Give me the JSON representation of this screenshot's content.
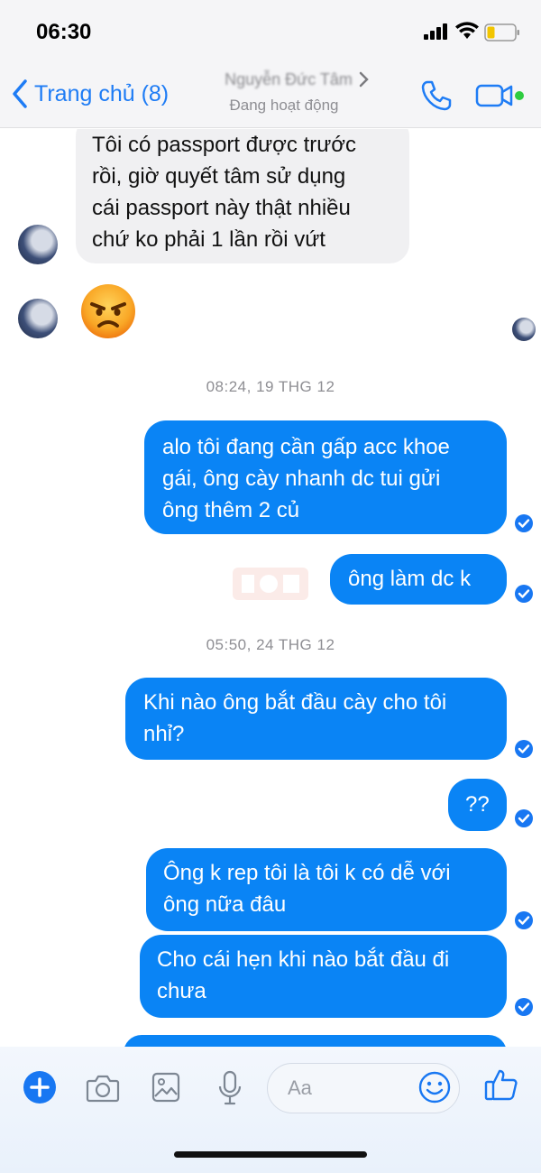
{
  "status_bar": {
    "time": "06:30"
  },
  "header": {
    "back_label": "Trang chủ (8)",
    "contact_name": "Nguyễn Đức Tâm",
    "contact_status": "Đang hoạt động"
  },
  "thread": {
    "incoming_message_1": [
      "Tôi có passport được trước",
      "rồi, giờ quyết tâm sử dụng",
      "cái passport này thật nhiều",
      "chứ ko phải 1 lần rồi vứt"
    ],
    "incoming_emoji": "😠",
    "timestamp_1": "08:24, 19 THG 12",
    "outgoing_1": [
      "alo tôi đang cần gấp acc khoe",
      "gái, ông cày nhanh dc tui gửi",
      "ông thêm 2 củ"
    ],
    "outgoing_2": [
      "ông làm dc k"
    ],
    "timestamp_2": "05:50, 24 THG 12",
    "outgoing_3": [
      "Khi nào ông bắt đầu cày cho tôi",
      "nhỉ?"
    ],
    "outgoing_4": [
      "??"
    ],
    "outgoing_5": [
      "Ông k rep tôi là tôi k có dễ với",
      "ông nữa đâu"
    ],
    "outgoing_6": [
      "Cho cái hẹn khi nào bắt đầu đi",
      "chưa"
    ]
  },
  "composer": {
    "placeholder": "Aa"
  },
  "colors": {
    "accent": "#0a84f5",
    "incoming_bubble": "#f0f0f2",
    "online_dot": "#2ecc40"
  },
  "icons": [
    "signal-icon",
    "wifi-icon",
    "battery-icon",
    "back-chevron-icon",
    "phone-icon",
    "video-icon",
    "seen-check-icon",
    "plus-icon",
    "camera-icon",
    "photo-icon",
    "mic-icon",
    "emoji-icon",
    "like-icon"
  ]
}
